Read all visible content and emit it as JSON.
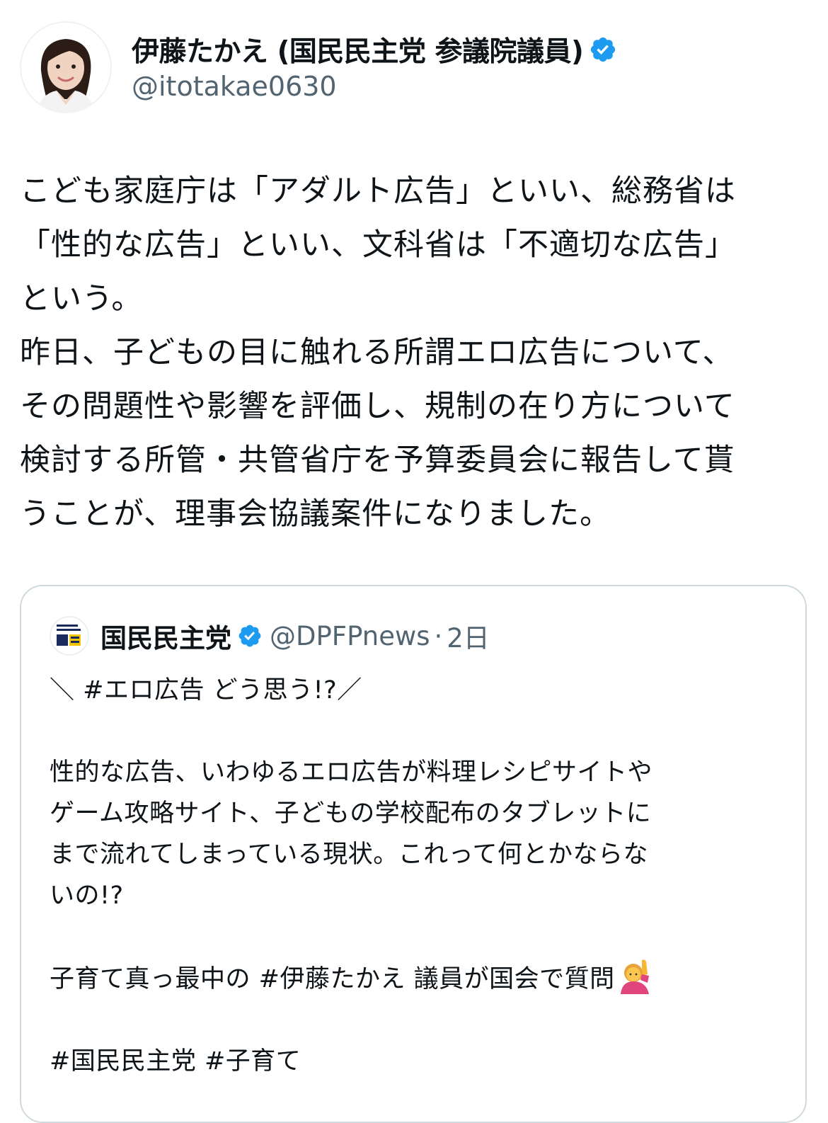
{
  "author": {
    "display_name": "伊藤たかえ (国民民主党 参議院議員)",
    "handle": "@itotakae0630",
    "avatar_icon": "profile-photo-icon",
    "verified_icon": "verified-badge-icon",
    "accent_color": "#1d9bf0"
  },
  "tweet": {
    "lines": [
      "こども家庭庁は「アダルト広告」といい、総務省は",
      "「性的な広告」といい、文科省は「不適切な広告」",
      "という。",
      "昨日、子どもの目に触れる所謂エロ広告について、",
      "その問題性や影響を評価し、規制の在り方について",
      "検討する所管・共管省庁を予算委員会に報告して貰",
      "うことが、理事会協議案件になりました。"
    ]
  },
  "quote": {
    "display_name": "国民民主党",
    "handle": "@DPFPnews",
    "separator": "·",
    "time": "2日",
    "lines": [
      "＼ #エロ広告 どう思う!?／",
      "",
      "性的な広告、いわゆるエロ広告が料理レシピサイトや",
      "ゲーム攻略サイト、子どもの学校配布のタブレットに",
      "まで流れてしまっている現状。これって何とかならな",
      "いの!?",
      "",
      "子育て真っ最中の #伊藤たかえ 議員が国会で質問",
      "",
      "#国民民主党 #子育て"
    ],
    "emoji_icon": "person-raising-hand-emoji"
  }
}
